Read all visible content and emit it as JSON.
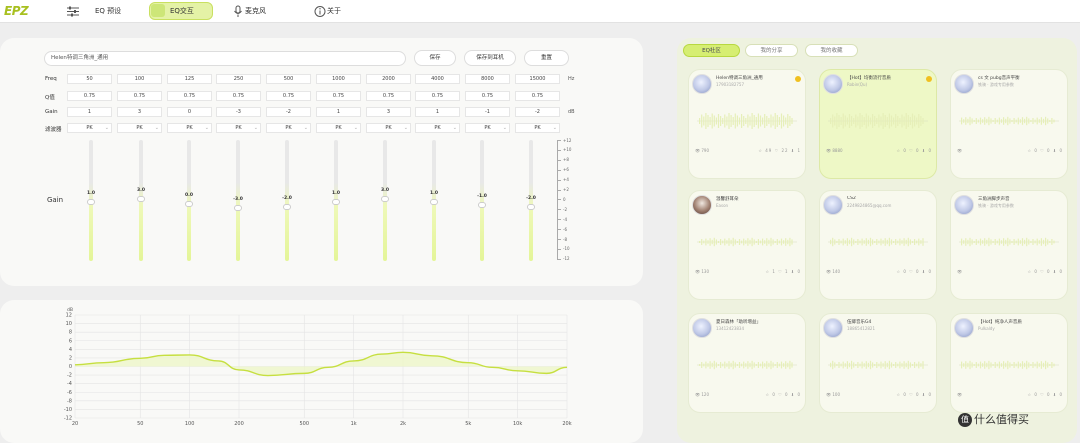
{
  "app": {
    "logo": "EPZ",
    "tabs": [
      {
        "label": "EQ 预设"
      },
      {
        "label": "EQ交互",
        "active": true
      },
      {
        "label": "麦克风"
      },
      {
        "label": "关于"
      }
    ]
  },
  "editor": {
    "name_value": "Helen特调三角洲_通用",
    "buttons": {
      "save": "保存",
      "save_device": "保存到耳机",
      "reset": "重置"
    },
    "rows": {
      "freq": "Freq",
      "q": "Q值",
      "gain": "Gain",
      "filter": "滤波器"
    },
    "units": {
      "freq": "Hz",
      "gain": "dB"
    },
    "gain_label": "Gain",
    "bands": [
      {
        "freq": "50",
        "q": "0.75",
        "gain": "1",
        "filter": "PK",
        "label": "1.0",
        "value": 1
      },
      {
        "freq": "100",
        "q": "0.75",
        "gain": "3",
        "filter": "PK",
        "label": "3.0",
        "value": 3
      },
      {
        "freq": "125",
        "q": "0.75",
        "gain": "0",
        "filter": "PK",
        "label": "0.0",
        "value": 0
      },
      {
        "freq": "250",
        "q": "0.75",
        "gain": "-3",
        "filter": "PK",
        "label": "-3.0",
        "value": -3
      },
      {
        "freq": "500",
        "q": "0.75",
        "gain": "-2",
        "filter": "PK",
        "label": "-2.0",
        "value": -2
      },
      {
        "freq": "1000",
        "q": "0.75",
        "gain": "1",
        "filter": "PK",
        "label": "1.0",
        "value": 1
      },
      {
        "freq": "2000",
        "q": "0.75",
        "gain": "3",
        "filter": "PK",
        "label": "3.0",
        "value": 3
      },
      {
        "freq": "4000",
        "q": "0.75",
        "gain": "1",
        "filter": "PK",
        "label": "1.0",
        "value": 1
      },
      {
        "freq": "8000",
        "q": "0.75",
        "gain": "-1",
        "filter": "PK",
        "label": "-1.0",
        "value": -1
      },
      {
        "freq": "15000",
        "q": "0.75",
        "gain": "-2",
        "filter": "PK",
        "label": "-2.0",
        "value": -2
      }
    ],
    "scale": [
      "+12",
      "+10",
      "+8",
      "+6",
      "+4",
      "+2",
      "0",
      "-2",
      "-4",
      "-6",
      "-8",
      "-10",
      "-12"
    ]
  },
  "chart_data": {
    "type": "line",
    "ylabel": "dB",
    "ylim": [
      -12,
      12
    ],
    "yticks": [
      "12",
      "10",
      "8",
      "6",
      "4",
      "2",
      "0",
      "-2",
      "-4",
      "-6",
      "-8",
      "-10",
      "-12"
    ],
    "xticks": [
      "20",
      "50",
      "100",
      "200",
      "500",
      "1k",
      "2k",
      "5k",
      "10k",
      "20k"
    ],
    "xtick_values": [
      20,
      50,
      100,
      200,
      500,
      1000,
      2000,
      5000,
      10000,
      20000
    ],
    "xscale": "log",
    "grid": true,
    "series": [
      {
        "x": [
          20,
          30,
          50,
          70,
          100,
          150,
          200,
          300,
          500,
          700,
          1000,
          1500,
          2000,
          3000,
          5000,
          7000,
          10000,
          15000,
          20000
        ],
        "y": [
          0.4,
          0.9,
          1.9,
          2.6,
          2.7,
          1.3,
          -0.8,
          -2.1,
          -1.6,
          -0.2,
          1.3,
          2.9,
          3.3,
          2.5,
          0.9,
          -0.2,
          -1.0,
          -1.6,
          -0.2
        ]
      }
    ],
    "colors": {
      "line": "#c6df40",
      "fill": "#eef6c8"
    }
  },
  "community": {
    "tabs": [
      {
        "label": "EQ社区",
        "active": true
      },
      {
        "label": "我的分享"
      },
      {
        "label": "我的收藏"
      }
    ],
    "cards": [
      {
        "title": "Helen特调三角洲_通用",
        "sub": "17903182757",
        "starred": true,
        "views": "790",
        "stats": "☆ 49 ♡ 22 ⬇ 1"
      },
      {
        "title": "【Hot】均衡流行音质",
        "sub": "Robin(Qu)",
        "starred": true,
        "views": "8880",
        "stats": "☆ 0 ♡ 0 ⬇ 0"
      },
      {
        "title": "cs 文 pubg音声平衡",
        "sub": "铁骑 · 游戏专用参数",
        "starred": false,
        "views": "",
        "stats": "☆ 0 ♡ 0 ⬇ 0"
      },
      {
        "title": "温馨舒耳朵",
        "sub": "Eason",
        "starred": false,
        "views": "130",
        "stats": "☆ 1 ♡ 1 ⬇ 0"
      },
      {
        "title": "CS2",
        "sub": "2249824865@qq.com",
        "starred": false,
        "views": "140",
        "stats": "☆ 0 ♡ 0 ⬇ 0"
      },
      {
        "title": "三角洲脚步声音",
        "sub": "铁骑 · 游戏专用参数",
        "starred": false,
        "views": "",
        "stats": "☆ 0 ♡ 0 ⬇ 0"
      },
      {
        "title": "夏日森林「助听增益」",
        "sub": "13412423834",
        "starred": false,
        "views": "120",
        "stats": "☆ 0 ♡ 0 ⬇ 0"
      },
      {
        "title": "伍卿音乐G4",
        "sub": "18865412821",
        "starred": false,
        "views": "100",
        "stats": "☆ 0 ♡ 0 ⬇ 0"
      },
      {
        "title": "【Hot】纯净人声音质",
        "sub": "Pulkaldy",
        "starred": false,
        "views": "",
        "stats": "☆ 0 ♡ 0 ⬇ 0"
      }
    ]
  },
  "watermark": {
    "badge": "值",
    "text": "什么值得买"
  }
}
